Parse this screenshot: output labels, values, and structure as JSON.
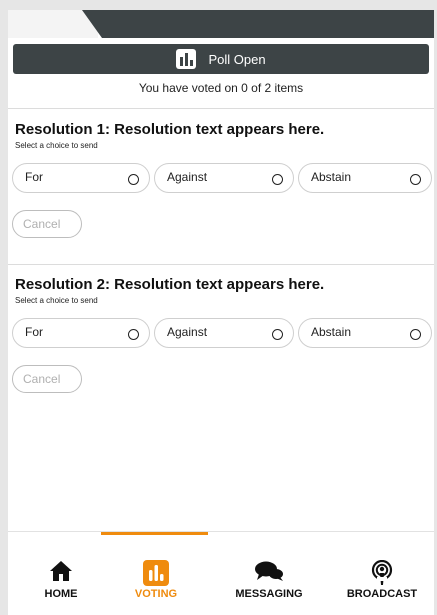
{
  "poll": {
    "status": "Poll Open",
    "voted_text": "You have voted on 0 of 2 items"
  },
  "resolutions": [
    {
      "title": "Resolution 1: Resolution text appears here.",
      "hint": "Select a choice to send",
      "choices": [
        "For",
        "Against",
        "Abstain"
      ],
      "cancel": "Cancel"
    },
    {
      "title": "Resolution 2: Resolution text appears here.",
      "hint": "Select a choice to send",
      "choices": [
        "For",
        "Against",
        "Abstain"
      ],
      "cancel": "Cancel"
    }
  ],
  "nav": {
    "items": [
      {
        "label": "HOME",
        "icon": "home-icon"
      },
      {
        "label": "VOTING",
        "icon": "poll-icon"
      },
      {
        "label": "MESSAGING",
        "icon": "chat-icon"
      },
      {
        "label": "BROADCAST",
        "icon": "podcast-icon"
      }
    ],
    "active": "VOTING"
  },
  "colors": {
    "dark": "#3d4446",
    "accent": "#ef8b0e"
  }
}
